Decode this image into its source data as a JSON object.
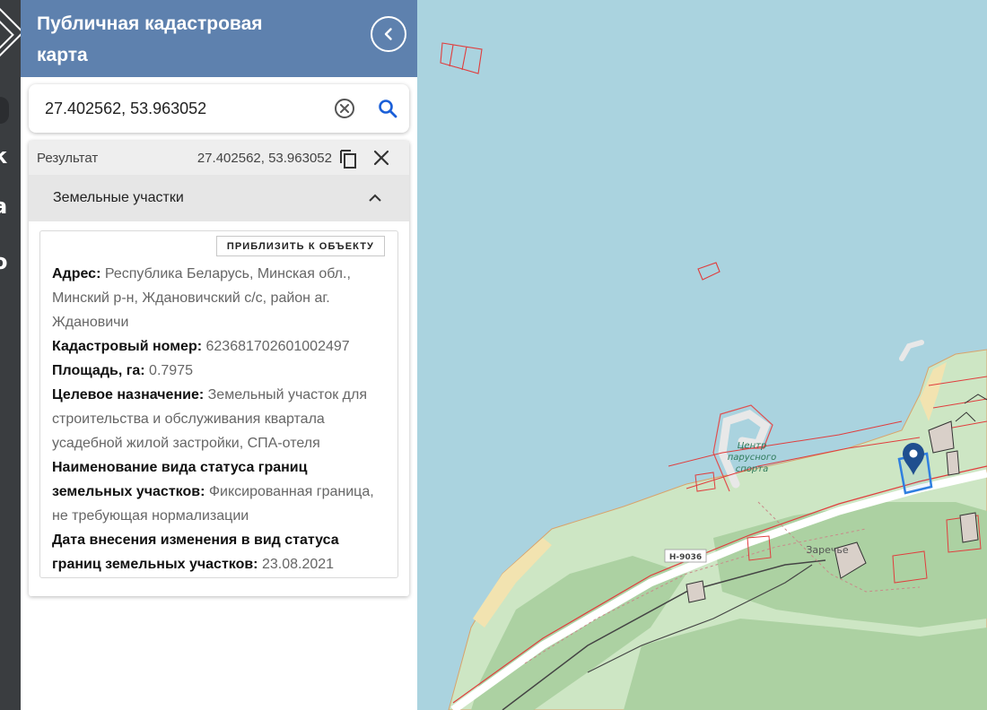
{
  "app": {
    "title": "Публичная кадастровая карта"
  },
  "search": {
    "value": "27.402562, 53.963052"
  },
  "result": {
    "label": "Результат",
    "coords": "27.402562, 53.963052",
    "section_title": "Земельные участки",
    "zoom_button": "ПРИБЛИЗИТЬ К ОБЪЕКТУ",
    "fields": [
      {
        "key": "Адрес:",
        "value": "Республика Беларусь, Минская обл., Минский р-н, Ждановичский с/с, район аг. Ждановичи"
      },
      {
        "key": "Кадастровый номер:",
        "value": "623681702601002497"
      },
      {
        "key": "Площадь, га:",
        "value": "0.7975"
      },
      {
        "key": "Целевое назначение:",
        "value": "Земельный участок для строительства и обслуживания квартала усадебной жилой застройки, СПА-отеля"
      },
      {
        "key": "Наименование вида статуса границ земельных участков:",
        "value": "Фиксированная граница, не требующая нормализации"
      },
      {
        "key": "Дата внесения изменения в вид статуса границ земельных участков:",
        "value": "23.08.2021"
      }
    ]
  },
  "map": {
    "labels": {
      "sport_line1": "Центр",
      "sport_line2": "парусного",
      "sport_line3": "спорта",
      "village": "Заречье",
      "road": "Н-9036"
    },
    "colors": {
      "water": "#aad3df",
      "land": "#cde6c4",
      "forest": "#acd1a2",
      "parcel": "#e03d3d",
      "marker": "#1f4f8f",
      "selected": "#2f7fe0"
    }
  },
  "icons": {
    "back": "chevron-left-icon",
    "clear": "clear-circle-icon",
    "search": "search-icon",
    "copy": "copy-icon",
    "close": "close-icon",
    "collapse": "chevron-up-icon",
    "marker": "map-pin-icon"
  }
}
